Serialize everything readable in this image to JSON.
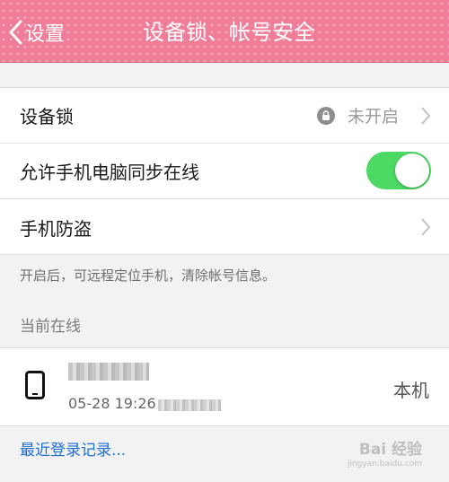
{
  "header": {
    "back_label": "设置",
    "title": "设备锁、帐号安全"
  },
  "settings": {
    "device_lock": {
      "label": "设备锁",
      "status": "未开启"
    },
    "sync_online": {
      "label": "允许手机电脑同步在线",
      "enabled": true
    },
    "anti_theft": {
      "label": "手机防盗"
    },
    "note": "开启后，可远程定位手机，清除帐号信息。"
  },
  "online": {
    "section_title": "当前在线",
    "device": {
      "time": "05-28 19:26",
      "this_device_label": "本机"
    }
  },
  "recent_login_link": "最近登录记录...",
  "watermark": {
    "text": "Bai 经验",
    "sub": "jingyan.baidu.com"
  },
  "colors": {
    "header": "#ef7d98",
    "toggle_on": "#4cd964",
    "link": "#1e6fd6"
  }
}
